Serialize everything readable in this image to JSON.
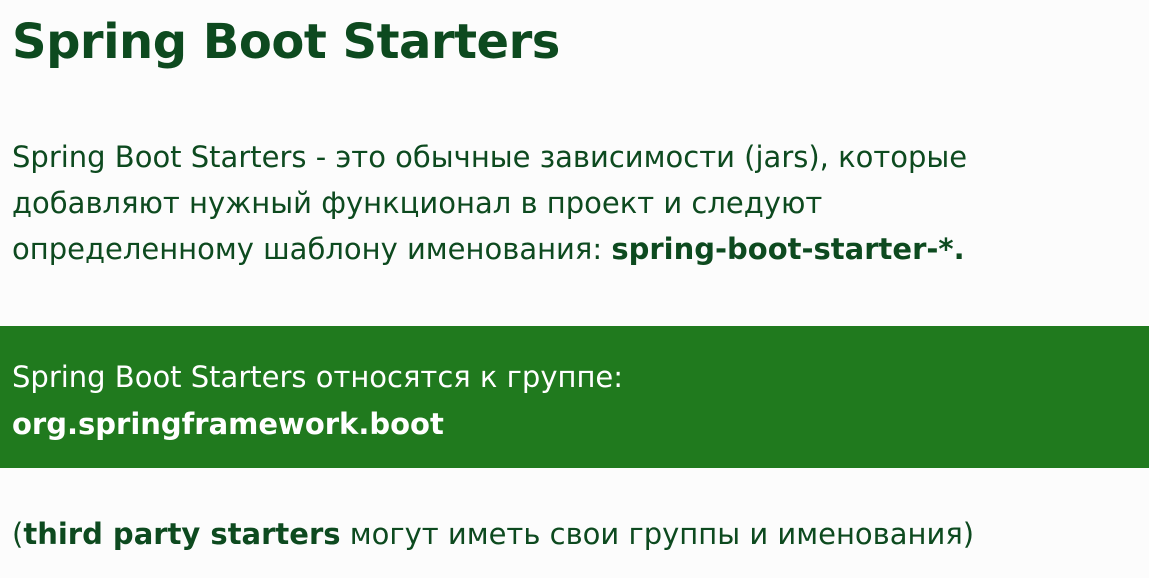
{
  "slide": {
    "title": "Spring Boot Starters",
    "paragraph": {
      "line1": "Spring Boot Starters - это обычные зависимости (jars), которые",
      "line2": "добавляют нужный функционал в проект и следуют",
      "line3_prefix": "определенному шаблону именования: ",
      "line3_bold": "spring-boot-starter-*."
    },
    "band": {
      "line1": "Spring Boot Starters относятся к группе:",
      "line2_bold": "org.springframework.boot"
    },
    "footer": {
      "open_paren": "(",
      "bold": "third party starters",
      "rest": " могут иметь свои группы и именования)"
    }
  },
  "colors": {
    "title_text": "#0d4a1f",
    "band_background": "#207a1e",
    "band_text": "#ffffff",
    "page_background": "#fcfcfc"
  }
}
